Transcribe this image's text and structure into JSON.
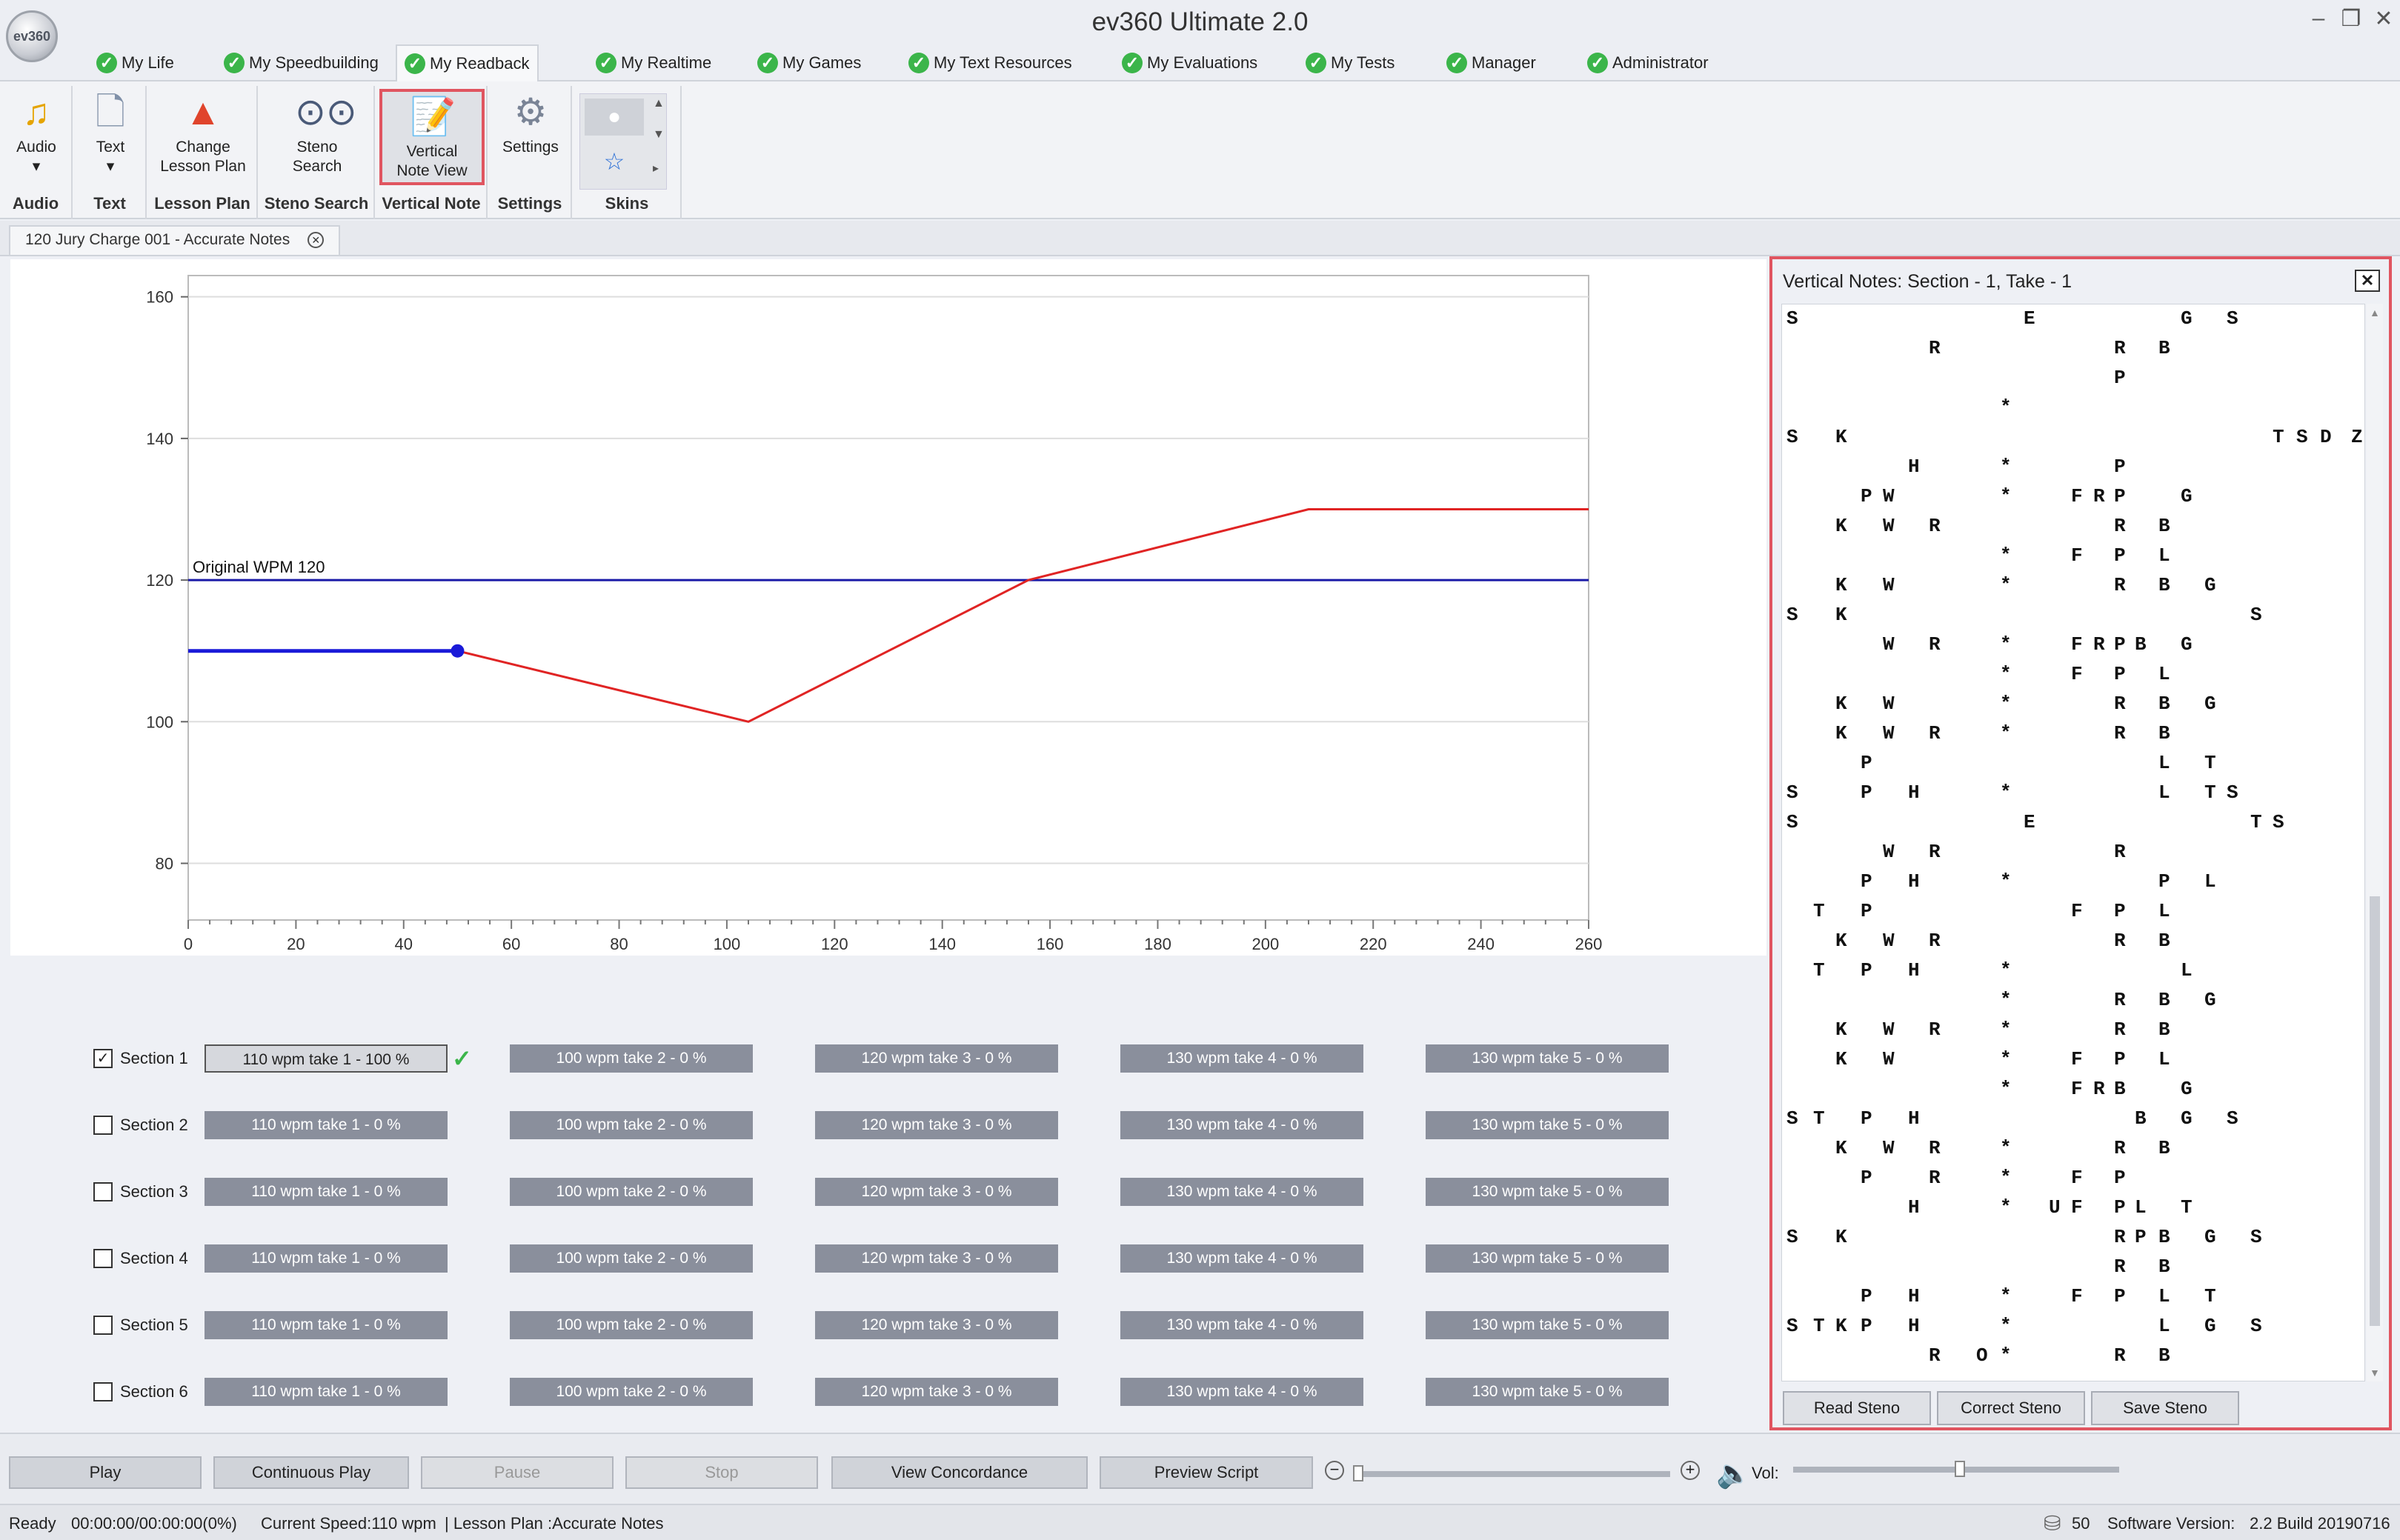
{
  "window": {
    "title": "ev360 Ultimate 2.0",
    "logo": "ev360"
  },
  "menu_tabs": [
    "My Life",
    "My Speedbuilding",
    "My Readback",
    "My Realtime",
    "My Games",
    "My Text Resources",
    "My Evaluations",
    "My Tests",
    "Manager",
    "Administrator"
  ],
  "active_menu": "My Readback",
  "ribbon": {
    "audio": {
      "button": "Audio",
      "group": "Audio"
    },
    "text": {
      "button": "Text",
      "group": "Text"
    },
    "lesson_plan": {
      "button_line1": "Change",
      "button_line2": "Lesson Plan",
      "group": "Lesson Plan"
    },
    "steno_search": {
      "button_line1": "Steno",
      "button_line2": "Search",
      "group": "Steno Search"
    },
    "vertical_note": {
      "button_line1": "Vertical",
      "button_line2": "Note View",
      "group": "Vertical Note"
    },
    "settings": {
      "button": "Settings",
      "group": "Settings"
    },
    "skins": {
      "group": "Skins"
    }
  },
  "document_tab": "120 Jury Charge 001 - Accurate Notes",
  "chart_data": {
    "type": "line",
    "xlim": [
      0,
      260
    ],
    "ylim": [
      72,
      163
    ],
    "x_ticks": [
      0,
      20,
      40,
      60,
      80,
      100,
      120,
      140,
      160,
      180,
      200,
      220,
      240,
      260
    ],
    "y_ticks": [
      80,
      100,
      120,
      140,
      160
    ],
    "reference_line": {
      "label": "Original WPM 120",
      "y": 120,
      "color": "#1a1aa8"
    },
    "series": [
      {
        "color": "#e02424",
        "points": [
          [
            50,
            110
          ],
          [
            104,
            100
          ],
          [
            156,
            120
          ],
          [
            208,
            130
          ],
          [
            260,
            130
          ]
        ]
      },
      {
        "color": "#1a1ad8",
        "points": [
          [
            0,
            110
          ],
          [
            50,
            110
          ]
        ]
      }
    ],
    "marker": {
      "x": 50,
      "y": 110
    },
    "grid": true
  },
  "sections": [
    {
      "label": "Section 1",
      "checked": true,
      "takes": [
        "110 wpm take 1 - 100 %",
        "100 wpm take 2 - 0 %",
        "120 wpm take 3 - 0 %",
        "130 wpm take 4 - 0 %",
        "130 wpm take 5 - 0 %"
      ]
    },
    {
      "label": "Section 2",
      "checked": false,
      "takes": [
        "110 wpm take 1 - 0 %",
        "100 wpm take 2 - 0 %",
        "120 wpm take 3 - 0 %",
        "130 wpm take 4 - 0 %",
        "130 wpm take 5 - 0 %"
      ]
    },
    {
      "label": "Section 3",
      "checked": false,
      "takes": [
        "110 wpm take 1 - 0 %",
        "100 wpm take 2 - 0 %",
        "120 wpm take 3 - 0 %",
        "130 wpm take 4 - 0 %",
        "130 wpm take 5 - 0 %"
      ]
    },
    {
      "label": "Section 4",
      "checked": false,
      "takes": [
        "110 wpm take 1 - 0 %",
        "100 wpm take 2 - 0 %",
        "120 wpm take 3 - 0 %",
        "130 wpm take 4 - 0 %",
        "130 wpm take 5 - 0 %"
      ]
    },
    {
      "label": "Section 5",
      "checked": false,
      "takes": [
        "110 wpm take 1 - 0 %",
        "100 wpm take 2 - 0 %",
        "120 wpm take 3 - 0 %",
        "130 wpm take 4 - 0 %",
        "130 wpm take 5 - 0 %"
      ]
    },
    {
      "label": "Section 6",
      "checked": false,
      "takes": [
        "110 wpm take 1 - 0 %",
        "100 wpm take 2 - 0 %",
        "120 wpm take 3 - 0 %",
        "130 wpm take 4 - 0 %",
        "130 wpm take 5 - 0 %"
      ]
    }
  ],
  "vertical_notes": {
    "title": "Vertical Notes: Section - 1, Take - 1",
    "keys": [
      "S",
      "T",
      "K",
      "P",
      "W",
      "H",
      "R",
      "A",
      "O",
      "*",
      "E",
      "U",
      "F",
      "R",
      "P",
      "B",
      "L",
      "G",
      "T",
      "S",
      "D",
      "Z"
    ],
    "rows": [
      "S.........E......G.S..",
      "......R.......R.B.....",
      "..............P.......",
      ".........*............",
      "S.K..................TSDZ",
      ".....H...*....P.......",
      "...PW....*..FRP..G....",
      "..K.W.R.......R.B.....",
      ".........*..F.P.L.....",
      "..K.W....*....R.B.G...",
      "S.K.................S.",
      "....W.R..*..FRPB.G....",
      ".........*..F.P.L.....",
      "..K.W....*....R.B.G...",
      "..K.W.R..*....R.B.....",
      "...P............L.T...",
      "S..P.H...*......L.TS..",
      "S.........E.........TS",
      "....W.R.......R.......",
      "...P.H...*......P.L...",
      ".T.P........F.P.L.....",
      "..K.W.R.......R.B.....",
      ".T.P.H...*.......L....",
      ".........*....R.B.G...",
      "..K.W.R..*....R.B.....",
      "..K.W....*..F.P.L.....",
      ".........*..FRB..G....",
      "ST.P.H.........B.G.S..",
      "..K.W.R..*....R.B.....",
      "...P..R..*..F.P.......",
      ".....H...*.UF.PL.T....",
      "S.K...........RPB.G.S.",
      "..............R.B.....",
      "...P.H...*..F.P.L.T...",
      "STKP.H...*......L.G.S.",
      "......R.O*....R.B....."
    ],
    "buttons": [
      "Read Steno",
      "Correct Steno",
      "Save Steno"
    ]
  },
  "playback": {
    "buttons": [
      "Play",
      "Continuous Play",
      "Pause",
      "Stop",
      "View Concordance",
      "Preview  Script"
    ],
    "disabled": [
      "Pause",
      "Stop"
    ],
    "vol_label": "Vol:"
  },
  "status": {
    "ready": "Ready",
    "time": "00:00:00/00:00:00(0%)",
    "speed": "Current Speed:110 wpm",
    "lesson": "| Lesson Plan :Accurate Notes",
    "count": "50",
    "version_label": "Software Version:",
    "version": "2.2 Build 20190716"
  }
}
